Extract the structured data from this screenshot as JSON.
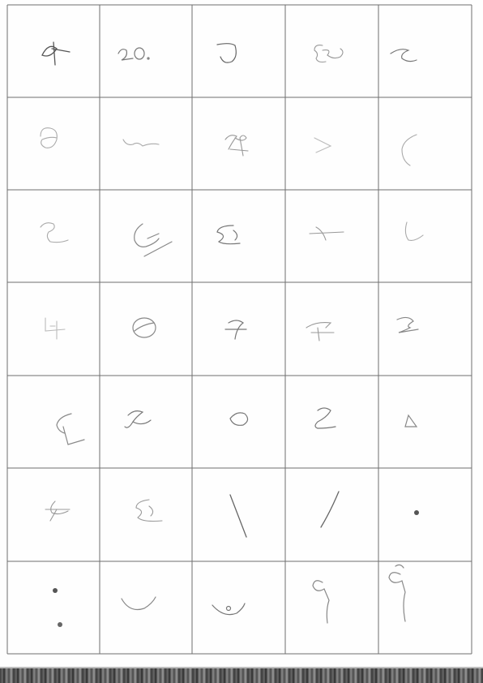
{
  "document": {
    "kind": "handwriting-sample-sheet",
    "rows": 7,
    "cols": 5,
    "cells": [
      [
        "glyph-r1c1",
        "glyph-r1c2",
        "glyph-r1c3",
        "glyph-r1c4",
        "glyph-r1c5"
      ],
      [
        "glyph-r2c1",
        "glyph-r2c2",
        "glyph-r2c3",
        "glyph-r2c4",
        "glyph-r2c5"
      ],
      [
        "glyph-r3c1",
        "glyph-r3c2",
        "glyph-r3c3",
        "glyph-r3c4",
        "glyph-r3c5"
      ],
      [
        "glyph-r4c1",
        "glyph-r4c2",
        "glyph-r4c3",
        "glyph-r4c4",
        "glyph-r4c5"
      ],
      [
        "glyph-r5c1",
        "glyph-r5c2",
        "glyph-r5c3",
        "glyph-r5c4",
        "glyph-r5c5"
      ],
      [
        "glyph-r6c1",
        "glyph-r6c2",
        "glyph-r6c3",
        "glyph-r6c4",
        "glyph-r6c5"
      ],
      [
        "glyph-r7c1",
        "glyph-r7c2",
        "glyph-r7c3",
        "glyph-r7c4",
        "glyph-r7c5"
      ]
    ],
    "colors": {
      "grid_line": "#6f6f6f",
      "ink_dark": "#5a5a5a",
      "ink_light": "#a8a8a8",
      "scan_band": "#3c3c3c"
    }
  }
}
